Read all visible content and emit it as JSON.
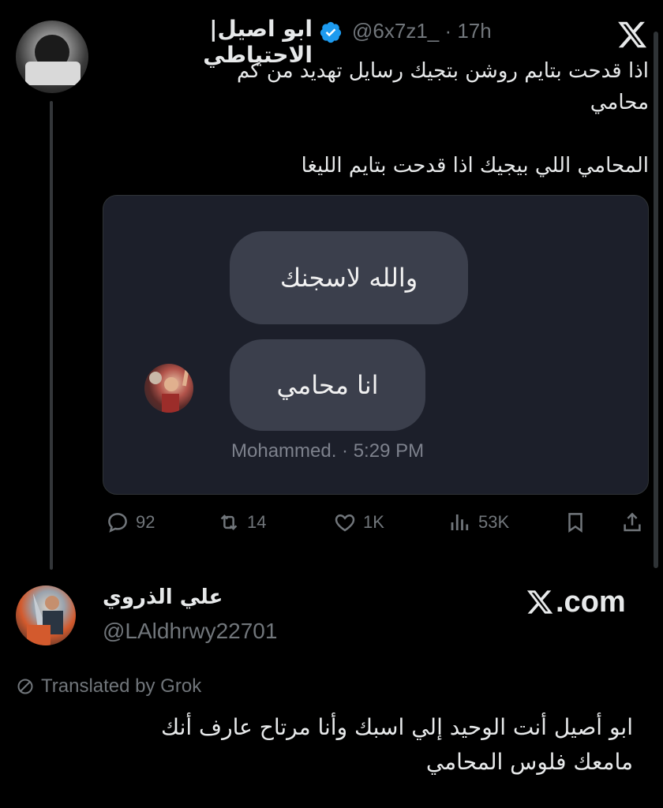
{
  "tweet": {
    "author_name": "ابو اصيل| الاحتياطي",
    "handle": "@6x7z1_",
    "time": "· 17h",
    "text_lines": [
      "اذا قدحت بتايم روشن بتجيك رسايل تهديد من كم",
      "محامي",
      "المحامي اللي بيجيك اذا قدحت بتايم الليغا"
    ],
    "media": {
      "bubble_1": "والله لاسجنك",
      "bubble_2": "انا محامي",
      "meta": "Mohammed.  · 5:29 PM"
    },
    "stats": {
      "replies": "92",
      "reposts": "14",
      "likes": "1K",
      "views": "53K"
    }
  },
  "reply": {
    "author_name": "علي الذروي",
    "handle": "@LAldhrwy22701",
    "brand": ".com",
    "translated_label": "Translated by Grok",
    "text_lines": [
      "ابو أصيل أنت الوحيد إلي اسبك وأنا مرتاح عارف أنك",
      "مامعك فلوس المحامي"
    ]
  },
  "colors": {
    "background": "#000000",
    "text": "#e7e9ea",
    "muted": "#71767b",
    "verified": "#1d9bf0",
    "chat_bg": "#1c1f2a",
    "bubble": "#3b3f4c"
  },
  "icons": [
    "x-logo-icon",
    "verified-badge-icon",
    "reply-icon",
    "repost-icon",
    "like-icon",
    "views-icon",
    "bookmark-icon",
    "share-icon",
    "translate-icon"
  ]
}
